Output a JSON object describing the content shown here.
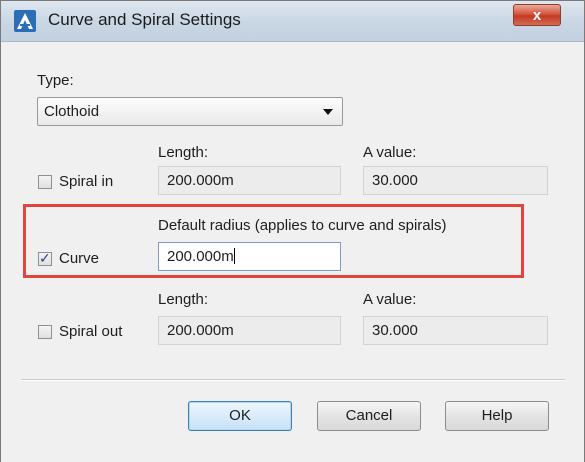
{
  "window": {
    "title": "Curve and Spiral Settings",
    "close_label": "x",
    "icon": "autocad-civil-icon"
  },
  "type": {
    "label": "Type:",
    "selected": "Clothoid"
  },
  "spiral_in": {
    "label": "Spiral in",
    "checked": false,
    "length_label": "Length:",
    "length_value": "200.000m",
    "a_label": "A value:",
    "a_value": "30.000"
  },
  "curve": {
    "label": "Curve",
    "checked": true,
    "radius_label": "Default radius (applies to curve and spirals)",
    "radius_value": "200.000m",
    "check_mark": "✓"
  },
  "spiral_out": {
    "label": "Spiral out",
    "checked": false,
    "length_label": "Length:",
    "length_value": "200.000m",
    "a_label": "A value:",
    "a_value": "30.000"
  },
  "buttons": {
    "ok": "OK",
    "cancel": "Cancel",
    "help": "Help"
  },
  "colors": {
    "highlight": "#e0463d",
    "close_button": "#c43a24"
  }
}
